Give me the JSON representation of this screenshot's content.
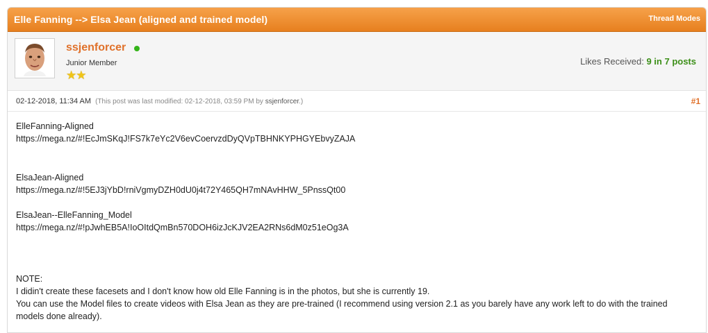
{
  "thread": {
    "title": "Elle Fanning --> Elsa Jean (aligned and trained model)",
    "modes_label": "Thread Modes"
  },
  "author": {
    "avatar_icon": "user-avatar-photo",
    "name": "ssjenforcer",
    "status": "online",
    "rank": "Junior Member",
    "stars": "★★",
    "likes_label": "Likes Received:",
    "likes_value": "9 in 7 posts"
  },
  "post": {
    "date": "02-12-2018, 11:34 AM",
    "edit_prefix": "(This post was last modified: 02-12-2018, 03:59 PM by",
    "edit_user": "ssjenforcer",
    "edit_suffix": ".)",
    "number": "#1",
    "body": {
      "label_1": "ElleFanning-Aligned",
      "link_1": "https://mega.nz/#!EcJmSKqJ!FS7k7eYc2V6evCoervzdDyQVpTBHNKYPHGYEbvyZAJA",
      "label_2": "ElsaJean-Aligned",
      "link_2": "https://mega.nz/#!5EJ3jYbD!rniVgmyDZH0dU0j4t72Y465QH7mNAvHHW_5PnssQt00",
      "label_3": "ElsaJean--ElleFanning_Model",
      "link_3": "https://mega.nz/#!pJwhEB5A!IoOItdQmBn570DOH6izJcKJV2EA2RNs6dM0z51eOg3A",
      "note_title": "NOTE:",
      "note_line_1": "I didin't create these facesets and I don't know how old Elle Fanning is in the photos, but she is currently 19.",
      "note_line_2": "You can use the Model files to create videos with Elsa Jean as they are pre-trained (I recommend using version 2.1 as you barely have any work left to do with the trained models done already)."
    }
  },
  "colors": {
    "header_orange": "#e7801f",
    "author_name": "#e0712a",
    "online_green": "#35b41a",
    "likes_green": "#3c8f18",
    "star_gold": "#f0c519"
  }
}
